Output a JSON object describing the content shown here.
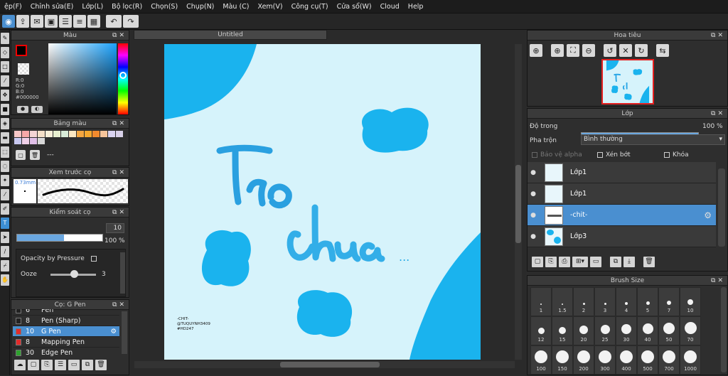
{
  "menu": [
    "ệp(F)",
    "Chỉnh sửa(E)",
    "Lớp(L)",
    "Bộ lọc(R)",
    "Chọn(S)",
    "Chụp(N)",
    "Màu (C)",
    "Xem(V)",
    "Công cụ(T)",
    "Cửa sổ(W)",
    "Cloud",
    "Help"
  ],
  "document": {
    "tab_title": "Untitled"
  },
  "color_panel": {
    "title": "Màu",
    "r": "R:0",
    "g": "G:0",
    "b": "B:0",
    "hex": "#000000"
  },
  "palette_panel": {
    "title": "Bảng màu",
    "name": "---",
    "swatches": [
      "#f7c6c6",
      "#f7a8a8",
      "#f3d4d4",
      "#f5e0c8",
      "#f8efd9",
      "#e8f0d0",
      "#d8ecd8",
      "#fbe7c2",
      "#f4a640",
      "#f5a82f",
      "#f28a2e",
      "#f6c49a",
      "#d9d3f0",
      "#d8d0e8",
      "#c8c8f0",
      "#f0d0e8",
      "#e0c0e8",
      "#d8d8d8"
    ]
  },
  "brush_preview_panel": {
    "title": "Xem trước cọ",
    "size_label": "0.73mm"
  },
  "brush_control_panel": {
    "title": "Kiểm soát cọ",
    "size_value": "10",
    "opacity_value": "100 %",
    "size_fill": 0.55,
    "opacity_fill": 1.0,
    "opacity_by_pressure": "Opacity by Pressure",
    "ooze_label": "Ooze",
    "ooze_value": "3"
  },
  "brush_list_panel": {
    "title": "Cọ: G Pen",
    "items": [
      {
        "size": "6",
        "name": "Pen",
        "color": "#222",
        "selected": false
      },
      {
        "size": "8",
        "name": "Pen (Sharp)",
        "color": "#222",
        "selected": false
      },
      {
        "size": "10",
        "name": "G Pen",
        "color": "#e32b2b",
        "selected": true
      },
      {
        "size": "8",
        "name": "Mapping Pen",
        "color": "#e32b2b",
        "selected": false
      },
      {
        "size": "30",
        "name": "Edge Pen",
        "color": "#2ea32e",
        "selected": false
      }
    ]
  },
  "canvas": {
    "bg": "#d6f3fb",
    "blob": "#1ab3ee",
    "word1": "Trở",
    "word2": "chừa",
    "dots": "...",
    "sig1": "-CHIT-",
    "sig2": "@TUQUYNH3409",
    "sig3": "#HD247"
  },
  "navigator_panel": {
    "title": "Hoa tiêu"
  },
  "layer_panel": {
    "title": "Lớp",
    "opacity_label": "Độ trong",
    "opacity_value": "100 %",
    "blend_label": "Pha trộn",
    "blend_value": "Bình thường",
    "protect_alpha": "Bảo vệ alpha",
    "clipping": "Xén bớt",
    "lock": "Khóa",
    "layers": [
      {
        "name": "Lớp1",
        "selected": false
      },
      {
        "name": "Lớp1",
        "selected": false
      },
      {
        "name": "-chit-",
        "selected": true
      },
      {
        "name": "Lớp3",
        "selected": false
      }
    ]
  },
  "brush_size_panel": {
    "title": "Brush Size",
    "sizes": [
      "1",
      "1.5",
      "2",
      "3",
      "4",
      "5",
      "7",
      "10",
      "12",
      "15",
      "20",
      "25",
      "30",
      "40",
      "50",
      "70",
      "100",
      "150",
      "200",
      "300",
      "400",
      "500",
      "700",
      "1000"
    ]
  }
}
